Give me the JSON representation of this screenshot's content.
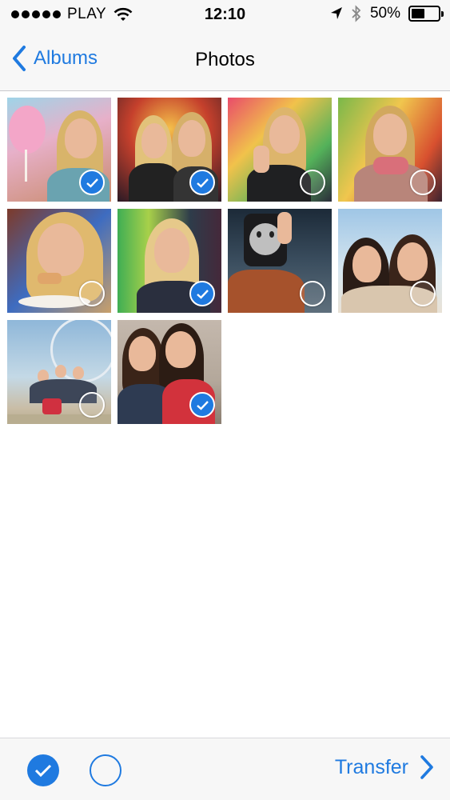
{
  "status_bar": {
    "carrier": "PLAY",
    "time": "12:10",
    "battery_percent": "50%",
    "battery_level": 0.5,
    "icons": [
      "signal-dots-icon",
      "wifi-icon",
      "location-arrow-icon",
      "bluetooth-icon",
      "battery-icon"
    ]
  },
  "nav": {
    "back_label": "Albums",
    "title": "Photos"
  },
  "photos": [
    {
      "subject": "cotton-candy-girl",
      "selected": true
    },
    {
      "subject": "two-girls-fairground-night",
      "selected": true
    },
    {
      "subject": "girl-thumbs-up",
      "selected": false
    },
    {
      "subject": "girl-scarf-fair",
      "selected": false
    },
    {
      "subject": "girl-eating",
      "selected": false
    },
    {
      "subject": "girl-smiling-fair",
      "selected": true
    },
    {
      "subject": "smiley-bag-person",
      "selected": false
    },
    {
      "subject": "two-girls-selfie",
      "selected": false
    },
    {
      "subject": "friends-selfie-ferris-wheel",
      "selected": false
    },
    {
      "subject": "two-girls-phone",
      "selected": true
    }
  ],
  "toolbar": {
    "transfer_label": "Transfer"
  },
  "colors": {
    "accent": "#1f7ae0",
    "bar_background": "#f7f7f7"
  }
}
